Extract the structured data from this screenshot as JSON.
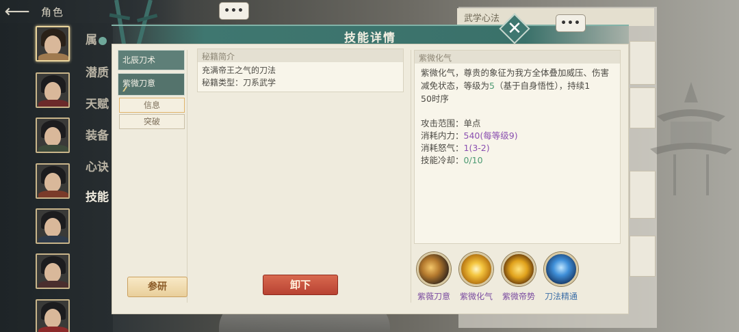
{
  "topbar": {
    "back_icon": "back-arrow-icon",
    "title": "角色"
  },
  "sidebar": {
    "tabs": [
      "属",
      "潜质",
      "天赋",
      "装备",
      "心诀",
      "技能"
    ],
    "current_tab_index": 5,
    "portraits_count": 7
  },
  "dialog": {
    "title": "技能详情",
    "close_icon": "close-icon",
    "skills": [
      {
        "name": "北辰刀术"
      },
      {
        "name": "紫微刀意",
        "pips": "⁄⁄⁄"
      }
    ],
    "sub_buttons": [
      "信息",
      "突破"
    ],
    "research_button": "参研",
    "unload_button": "卸下",
    "intro": {
      "head": "秘籍简介",
      "line1": "充满帝王之气的刀法",
      "line2": "秘籍类型：刀系武学"
    },
    "detail": {
      "head": "紫微化气",
      "desc_a": "紫微化气，尊贵的象征为我方全体叠加威压、伤害减免状态，等级为",
      "desc_level": "5",
      "desc_b": "（基于自身悟性），持续1",
      "desc_c": "50时序",
      "stats": [
        {
          "label": "攻击范围：",
          "value": "单点",
          "color": "normal"
        },
        {
          "label": "消耗内力：",
          "value": "540(每等级9)",
          "color": "purple"
        },
        {
          "label": "消耗怒气：",
          "value": "1(3-2)",
          "color": "purple"
        },
        {
          "label": "技能冷却：",
          "value": "0/10",
          "color": "green"
        }
      ]
    },
    "skill_icons": [
      {
        "name": "紫薇刀意",
        "icon": "blade-slash-icon",
        "color": "#7a4ba0"
      },
      {
        "name": "紫微化气",
        "icon": "radiant-burst-icon",
        "color": "#7a4ba0"
      },
      {
        "name": "紫微帝势",
        "icon": "golden-orb-icon",
        "color": "#7a4ba0"
      },
      {
        "name": "刀法精通",
        "icon": "meditation-figure-icon",
        "color": "#3d6fa8"
      }
    ]
  },
  "background": {
    "strip_title": "武学心法",
    "chat_bubble_text": "•••"
  }
}
